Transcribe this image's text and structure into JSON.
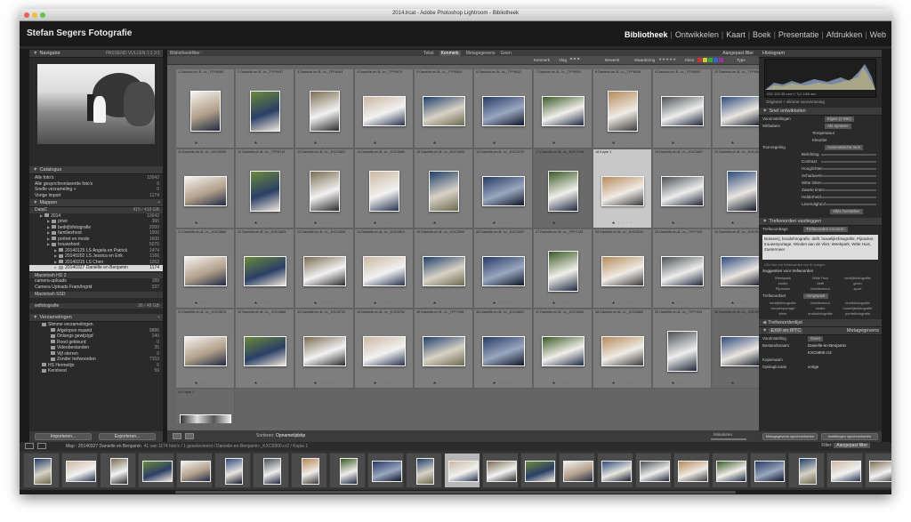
{
  "window_title": "2014.lrcat - Adobe Photoshop Lightroom - Bibliotheek",
  "identity_plate": "Stefan Segers Fotografie",
  "modules": [
    "Bibliotheek",
    "Ontwikkelen",
    "Kaart",
    "Boek",
    "Presentatie",
    "Afdrukken",
    "Web"
  ],
  "active_module": "Bibliotheek",
  "left": {
    "navigator_title": "Navigator",
    "navigator_modes": "PASSEND  VULLEN  1:1  3:1",
    "catalog_title": "Catalogus",
    "catalog_items": [
      {
        "label": "Alle foto's",
        "count": "10042"
      },
      {
        "label": "Alle gesynchroniseerde foto's",
        "count": "0"
      },
      {
        "label": "Snelle verzameling +",
        "count": "0"
      },
      {
        "label": "Vorige import",
        "count": "1174"
      }
    ],
    "folders_title": "Mappen",
    "volume_1": {
      "name": "DataC",
      "info": "415 / 419 GB"
    },
    "folder_items": [
      {
        "label": "2014",
        "count": "10042",
        "depth": 1
      },
      {
        "label": "privé",
        "count": "366",
        "depth": 2
      },
      {
        "label": "bedrijfsfotografie",
        "count": "2000",
        "depth": 2
      },
      {
        "label": "familieshoot",
        "count": "1000",
        "depth": 2
      },
      {
        "label": "portret en mode",
        "count": "1600",
        "depth": 2
      },
      {
        "label": "trouwshoot",
        "count": "5076",
        "depth": 2
      },
      {
        "label": "20140125 LS Angela en Patrick",
        "count": "1474",
        "depth": 3
      },
      {
        "label": "20140202 LS Jessica en Erik",
        "count": "1166",
        "depth": 3
      },
      {
        "label": "20140315 LS Chen",
        "count": "1262",
        "depth": 3
      },
      {
        "label": "20140327 Daniëlle en Benjamin",
        "count": "1174",
        "depth": 3,
        "selected": true
      }
    ],
    "volume_2": {
      "name": "Macintosh HD 2",
      "info": ""
    },
    "volume_2_items": [
      {
        "label": "camera-uploads",
        "count": "189"
      },
      {
        "label": "Camera Uploads Fram/Ingrid",
        "count": "237"
      }
    ],
    "volume_3": {
      "name": "Macintosh SSD",
      "info": ""
    },
    "volume_4": {
      "name": "wdfotografie",
      "info": "36 / 48 GB"
    },
    "collections_title": "Verzamelingen",
    "collection_items": [
      {
        "label": "Slimme verzamelingen",
        "count": ""
      },
      {
        "label": "Afgelopen maand",
        "count": "9886"
      },
      {
        "label": "Onlangs gewijzigd",
        "count": "140"
      },
      {
        "label": "Rood gekleurd",
        "count": "0"
      },
      {
        "label": "Videobestanden",
        "count": "25"
      },
      {
        "label": "Vijf sterren",
        "count": "0"
      },
      {
        "label": "Zonder trefwoorden",
        "count": "7153"
      },
      {
        "label": "HS Hermelijn",
        "count": "6"
      },
      {
        "label": "Kerstvest",
        "count": "59"
      }
    ],
    "import_button": "Importeren...",
    "export_button": "Exporteren..."
  },
  "center": {
    "header": "Bibliotheekfilter :",
    "filter_tabs": [
      "Tekst",
      "Kenmerk",
      "Metagegevens",
      "Geen"
    ],
    "active_filter": "Kenmerk",
    "attr_label": "Kenmerk",
    "flag_label": "Vlag",
    "edits_label": "Bewerkt",
    "rating_label": "Waardering",
    "color_label": "Kleur",
    "kind_label": "Type",
    "filter_preset": "Aangepast filter",
    "sort_label": "Sorteren:",
    "sort_value": "Opnametijdstip",
    "thumb_label": "Miniaturen",
    "cells": [
      {
        "n": "1",
        "cap": "Danielle-en-B...in-_TFP6455"
      },
      {
        "n": "2",
        "cap": "Danielle-en-B...in-_TFP6457"
      },
      {
        "n": "3",
        "cap": "Danielle-en-B...in-_TFP6464"
      },
      {
        "n": "4",
        "cap": "Danielle-en-B...in-_TFP6470"
      },
      {
        "n": "5",
        "cap": "Danielle-en-B...in-_TFP6504"
      },
      {
        "n": "6",
        "cap": "Danielle-en-B...in-_TFP6512"
      },
      {
        "n": "7",
        "cap": "Danielle-en-B...in-_TFP6520"
      },
      {
        "n": "8",
        "cap": "Danielle-en-B...in-_TFP6538"
      },
      {
        "n": "9",
        "cap": "Danielle-en-B...in-_TFP6551"
      },
      {
        "n": "10",
        "cap": "Danielle-en-B...in-_TFP6581"
      },
      {
        "n": "11",
        "cap": "Danielle-en-B...in-_KXC3635"
      },
      {
        "n": "12",
        "cap": "Danielle-en-B...in-_TFP6744"
      },
      {
        "n": "13",
        "cap": "Danielle-en-B...in-_KXC3652"
      },
      {
        "n": "14",
        "cap": "Danielle-en-B...in-_KXC3680"
      },
      {
        "n": "15",
        "cap": "Danielle-en-B...in-_KXC3696"
      },
      {
        "n": "16",
        "cap": "Danielle-en-B...in-_KXC3720"
      },
      {
        "n": "17",
        "cap": "Danielle-en-B...in-_KXC3765"
      },
      {
        "n": "18",
        "cap": "Kopie 1"
      },
      {
        "n": "19",
        "cap": "Danielle-en-B...in-_KXC3807"
      },
      {
        "n": "20",
        "cap": "Danielle-en-B...in-_KXC3818"
      },
      {
        "n": "21",
        "cap": "Danielle-en-B...in-_KXC3884"
      },
      {
        "n": "22",
        "cap": "Danielle-en-B...in-_KXC3893"
      },
      {
        "n": "23",
        "cap": "Danielle-en-B...in-_KXC3908"
      },
      {
        "n": "24",
        "cap": "Danielle-en-B...in-_KXC3914"
      },
      {
        "n": "25",
        "cap": "Danielle-en-B...in-_KXC3999"
      },
      {
        "n": "26",
        "cap": "Danielle-en-B...in-_KXC3987"
      },
      {
        "n": "27",
        "cap": "Danielle-en-B...in-_TFP7124"
      },
      {
        "n": "28",
        "cap": "Danielle-en-B...in-_KXC5049"
      },
      {
        "n": "29",
        "cap": "Danielle-en-B...in-_TFP7193"
      },
      {
        "n": "30",
        "cap": "Danielle-en-B...in-_KXC5148"
      },
      {
        "n": "31",
        "cap": "Danielle-en-B...in-_KXC6678"
      },
      {
        "n": "32",
        "cap": "Danielle-en-B...in-_KXC6686"
      },
      {
        "n": "33",
        "cap": "Danielle-en-B...in-_KXC6720"
      },
      {
        "n": "34",
        "cap": "Danielle-en-B...in-_KXC6752"
      },
      {
        "n": "35",
        "cap": "Danielle-en-B...in-_TFP7408"
      },
      {
        "n": "36",
        "cap": "Danielle-en-B...in-_KXC6801"
      },
      {
        "n": "37",
        "cap": "Danielle-en-B...in-_KXC6830"
      },
      {
        "n": "38",
        "cap": "Danielle-en-B...in-_KXC6860"
      },
      {
        "n": "39",
        "cap": "Danielle-en-B...in-_TFP7424"
      },
      {
        "n": "40",
        "cap": "Danielle-en-B...in-_KXC6926"
      },
      {
        "n": "41",
        "cap": "Kopie 1"
      }
    ]
  },
  "right": {
    "histogram_title": "Histogram",
    "hist_info": "ISO 100   35 mm   f / 3,2   1/60 sec",
    "original_label": "Origineel + slimme voorvertoning",
    "quick_develop_title": "Snel ontwikkelen",
    "saved_preset_label": "Voorinstellingen",
    "saved_preset_value": "Eigen (2 Mei)",
    "wb_label": "Witbalans",
    "wb_value": "Als opname",
    "temp_label": "Temperatuur",
    "tint_label": "Kleurtint",
    "tone_label": "Toonregeling",
    "tone_auto": "Automatische toon",
    "tone_rows": [
      "Belichting",
      "Contrast",
      "Hooglichten",
      "Schaduwen",
      "Witte tinten",
      "Zwarte tinten",
      "Helderheid",
      "Levendigheid"
    ],
    "reset_label": "Alles herstellen",
    "keywording_title": "Trefwoorden vastleggen",
    "kw_tags_label": "Trefwoordtags",
    "kw_tags_value": "Trefwoorden invoeren",
    "kw_text": "Brasserij, bruidsfotografie, delft, huwelijksfotografie, Pijnacker, trouwreportage, Winden aan de Vliet, Weekpark, Witte Huis, Zoetermeer",
    "kw_hint": "Klik hier om trefwoorden toe te voegen",
    "suggest_title": "Suggesties voor trefwoorden",
    "suggest_words": [
      "Weekpark",
      "Witte Huis",
      "bedrijfsfotografie",
      "studio",
      "delft",
      "gezin",
      "Pijnacker",
      "familieshoot",
      "sport"
    ],
    "set_label": "Trefwoordset",
    "set_value": "Aangepast",
    "set_words": [
      "bedrijfsfotografie",
      "familieshoot",
      "bruidsfotografie",
      "trouwreportage",
      "studio",
      "huwelijksfotografie",
      "sfeer",
      "bruidsfotografie",
      "portretfotografie"
    ],
    "keyword_list_title": "Trefwoordenlijst",
    "metadata_title": "Metagegevens",
    "metadata_preset": "EXIF en IPTC",
    "meta_preset_label": "Voorinstelling",
    "meta_preset_value": "Geen",
    "meta_rows": [
      {
        "k": "Bestandsnaam",
        "v": "Danielle-en-Benjamin"
      },
      {
        "k": "",
        "v": "KXC6900.cr2"
      },
      {
        "k": "Kopienaam",
        "v": ""
      },
      {
        "k": "Opslaglocatie",
        "v": "vorige"
      }
    ],
    "sync_meta": "Metagegevens synchroniseren",
    "sync_settings": "Instellingen synchroniseren"
  },
  "filmstrip": {
    "path": "Map : 20140327 Danielle en Benjamin",
    "info": "41 van 1174 foto's / 1 geselecteerd / Danielle-en-Benjamin-_KXC6900.cr2 / Kopie 1",
    "filter_label": "Filter:",
    "filter_value": "Aangepast filter"
  }
}
